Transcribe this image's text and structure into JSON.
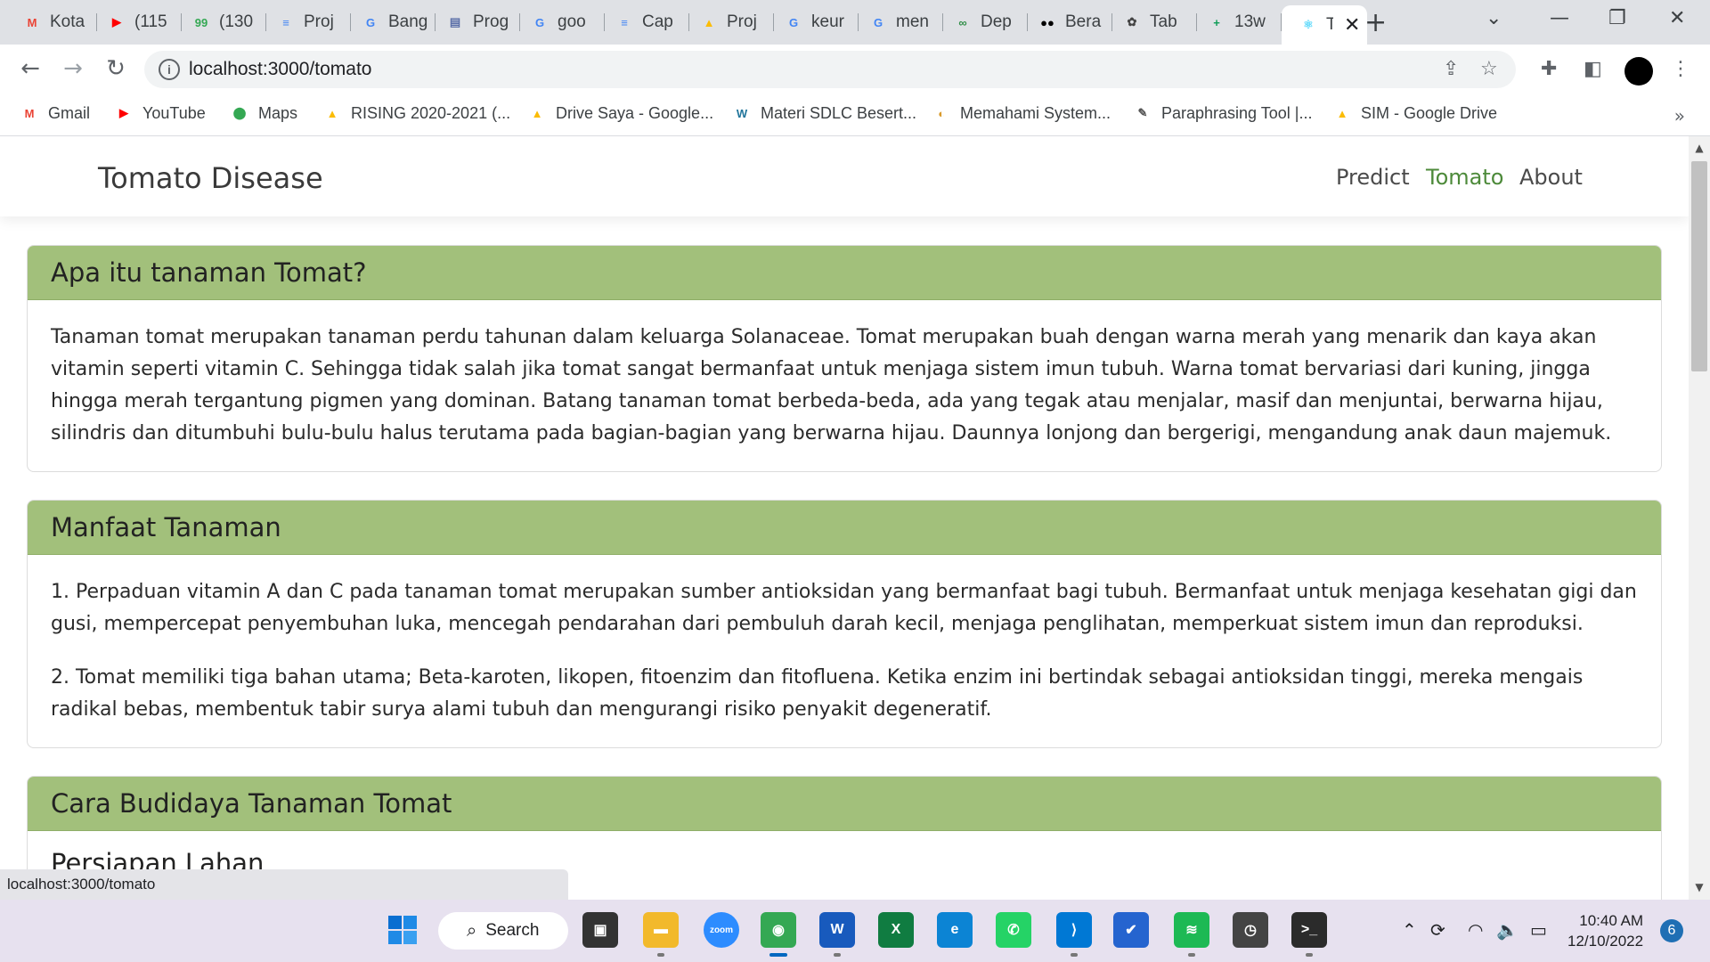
{
  "browser": {
    "tabs": [
      {
        "title": "Kota",
        "icon": "gmail-icon",
        "color": "#ea4335",
        "glyph": "M"
      },
      {
        "title": "(115",
        "icon": "youtube-icon",
        "color": "#ff0000",
        "glyph": "▶"
      },
      {
        "title": "(130",
        "icon": "messages-icon",
        "color": "#34a853",
        "glyph": "99"
      },
      {
        "title": "Proj",
        "icon": "docs-icon",
        "color": "#4285f4",
        "glyph": "≡"
      },
      {
        "title": "Bang",
        "icon": "google-icon",
        "color": "#4285f4",
        "glyph": "G"
      },
      {
        "title": "Prog",
        "icon": "site-icon",
        "color": "#5b6fa8",
        "glyph": "▤"
      },
      {
        "title": "goo",
        "icon": "google-icon",
        "color": "#4285f4",
        "glyph": "G"
      },
      {
        "title": "Cap",
        "icon": "docs-icon",
        "color": "#4285f4",
        "glyph": "≡"
      },
      {
        "title": "Proj",
        "icon": "drive-icon",
        "color": "#fbbc04",
        "glyph": "▲"
      },
      {
        "title": "keur",
        "icon": "google-icon",
        "color": "#4285f4",
        "glyph": "G"
      },
      {
        "title": "men",
        "icon": "google-icon",
        "color": "#4285f4",
        "glyph": "G"
      },
      {
        "title": "Dep",
        "icon": "geeks-icon",
        "color": "#2f8d46",
        "glyph": "∞"
      },
      {
        "title": "Bera",
        "icon": "medium-icon",
        "color": "#000000",
        "glyph": "●●"
      },
      {
        "title": "Tab",
        "icon": "chatgpt-icon",
        "color": "#444444",
        "glyph": "✿"
      },
      {
        "title": "13w",
        "icon": "sheets-icon",
        "color": "#0f9d58",
        "glyph": "+"
      },
      {
        "title": "T",
        "icon": "react-icon",
        "color": "#61dafb",
        "glyph": "⚛",
        "active": true
      }
    ],
    "new_tab": "+",
    "url": "localhost:3000/tomato"
  },
  "bookmarks": [
    {
      "label": "Gmail",
      "icon": "gmail-icon",
      "color": "#ea4335",
      "glyph": "M"
    },
    {
      "label": "YouTube",
      "icon": "youtube-icon",
      "color": "#ff0000",
      "glyph": "▶"
    },
    {
      "label": "Maps",
      "icon": "maps-icon",
      "color": "#34a853",
      "glyph": "⬤"
    },
    {
      "label": "RISING 2020-2021 (...",
      "icon": "drive-icon",
      "color": "#fbbc04",
      "glyph": "▲"
    },
    {
      "label": "Drive Saya - Google...",
      "icon": "drive-icon",
      "color": "#fbbc04",
      "glyph": "▲"
    },
    {
      "label": "Materi SDLC Besert...",
      "icon": "wordpress-icon",
      "color": "#21759b",
      "glyph": "W"
    },
    {
      "label": "Memahami System...",
      "icon": "site-icon",
      "color": "#d99a2b",
      "glyph": "◐"
    },
    {
      "label": "Paraphrasing Tool |...",
      "icon": "quill-icon",
      "color": "#555555",
      "glyph": "✎"
    },
    {
      "label": "SIM - Google Drive",
      "icon": "drive-icon",
      "color": "#fbbc04",
      "glyph": "▲"
    }
  ],
  "site": {
    "brand": "Tomato Disease",
    "nav": [
      "Predict",
      "Tomato",
      "About"
    ],
    "active_nav": "Tomato",
    "accent_color": "#a2c07b"
  },
  "sections": [
    {
      "title": "Apa itu tanaman Tomat?",
      "paragraphs": [
        "Tanaman tomat merupakan tanaman perdu tahunan dalam keluarga Solanaceae. Tomat merupakan buah dengan warna merah yang menarik dan kaya akan vitamin seperti vitamin C. Sehingga tidak salah jika tomat sangat bermanfaat untuk menjaga sistem imun tubuh. Warna tomat bervariasi dari kuning, jingga hingga merah tergantung pigmen yang dominan. Batang tanaman tomat berbeda-beda, ada yang tegak atau menjalar, masif dan menjuntai, berwarna hijau, silindris dan ditumbuhi bulu-bulu halus terutama pada bagian-bagian yang berwarna hijau. Daunnya lonjong dan bergerigi, mengandung anak daun majemuk."
      ]
    },
    {
      "title": "Manfaat Tanaman",
      "paragraphs": [
        "1. Perpaduan vitamin A dan C pada tanaman tomat merupakan sumber antioksidan yang bermanfaat bagi tubuh. Bermanfaat untuk menjaga kesehatan gigi dan gusi, mempercepat penyembuhan luka, mencegah pendarahan dari pembuluh darah kecil, menjaga penglihatan, memperkuat sistem imun dan reproduksi.",
        "2. Tomat memiliki tiga bahan utama; Beta-karoten, likopen, fitoenzim dan fitofluena. Ketika enzim ini bertindak sebagai antioksidan tinggi, mereka mengais radikal bebas, membentuk tabir surya alami tubuh dan mengurangi risiko penyakit degeneratif."
      ]
    },
    {
      "title": "Cara Budidaya Tanaman Tomat",
      "subheading": "Persiapan Lahan"
    }
  ],
  "status_tooltip": "localhost:3000/tomato",
  "taskbar": {
    "search_label": "Search",
    "apps": [
      {
        "name": "task-view-icon",
        "color": "#333333",
        "glyph": "▣"
      },
      {
        "name": "file-explorer-icon",
        "color": "#f2b92b",
        "glyph": "▬"
      },
      {
        "name": "zoom-icon",
        "color": "#2d8cff",
        "glyph": "zoom"
      },
      {
        "name": "chrome-icon",
        "color": "#34a853",
        "glyph": "◉"
      },
      {
        "name": "word-icon",
        "color": "#185abd",
        "glyph": "W"
      },
      {
        "name": "excel-icon",
        "color": "#107c41",
        "glyph": "X"
      },
      {
        "name": "edge-icon",
        "color": "#0c84d4",
        "glyph": "e"
      },
      {
        "name": "whatsapp-icon",
        "color": "#25d366",
        "glyph": "✆"
      },
      {
        "name": "vscode-icon",
        "color": "#0078d4",
        "glyph": "⟩"
      },
      {
        "name": "todo-icon",
        "color": "#2564cf",
        "glyph": "✔"
      },
      {
        "name": "spotify-icon",
        "color": "#1db954",
        "glyph": "≋"
      },
      {
        "name": "clock-icon",
        "color": "#444444",
        "glyph": "◷"
      },
      {
        "name": "terminal-icon",
        "color": "#2b2b2b",
        "glyph": ">_"
      }
    ],
    "time": "10:40 AM",
    "date": "12/10/2022",
    "notifications": "6"
  }
}
